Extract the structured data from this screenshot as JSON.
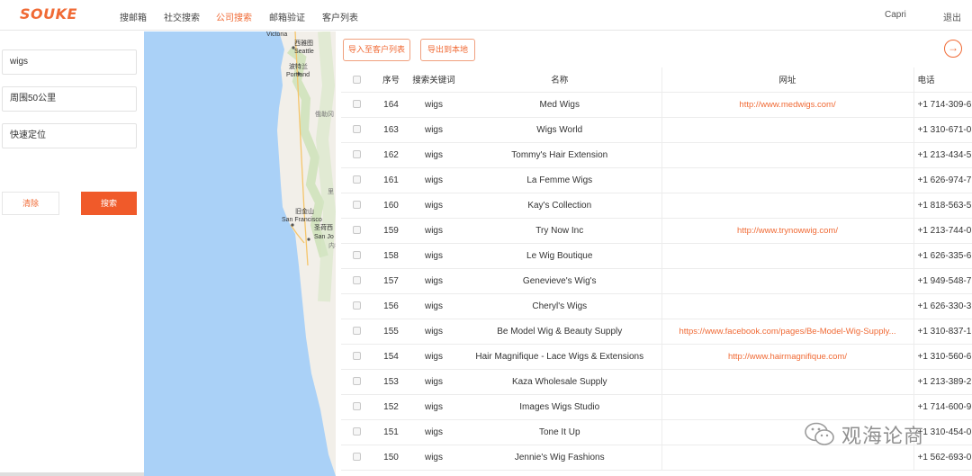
{
  "app": {
    "logo": "SOUKE"
  },
  "nav": {
    "items": [
      {
        "label": "搜邮箱",
        "active": false
      },
      {
        "label": "社交搜索",
        "active": false
      },
      {
        "label": "公司搜索",
        "active": true
      },
      {
        "label": "邮箱验证",
        "active": false
      },
      {
        "label": "客户列表",
        "active": false
      }
    ],
    "user": "Capri",
    "logout": "退出"
  },
  "search": {
    "keyword": "wigs",
    "radius": "周围50公里",
    "locate": "快速定位",
    "clear_label": "清除",
    "search_label": "搜索"
  },
  "map": {
    "labels": {
      "victoria": "Victoria",
      "seattle_cn": "西雅图",
      "seattle": "Seattle",
      "portland_cn": "波特兰",
      "portland": "Portland",
      "oregon": "俄勒冈",
      "sf_cn": "旧金山",
      "sf": "San Francisco",
      "sanjose_cn": "圣荷西",
      "sanjose": "San Jo",
      "reno": "里",
      "misc": "内华"
    }
  },
  "toolbar": {
    "import_label": "导入至客户列表",
    "export_label": "导出到本地",
    "next_icon": "arrow-right-circle-icon"
  },
  "table": {
    "headers": {
      "index": "序号",
      "keyword": "搜索关键词",
      "name": "名称",
      "url": "网址",
      "phone": "电话"
    },
    "rows": [
      {
        "index": "164",
        "keyword": "wigs",
        "name": "Med Wigs",
        "url": "http://www.medwigs.com/",
        "phone": "+1 714-309-6"
      },
      {
        "index": "163",
        "keyword": "wigs",
        "name": "Wigs World",
        "url": "",
        "phone": "+1 310-671-0"
      },
      {
        "index": "162",
        "keyword": "wigs",
        "name": "Tommy's Hair Extension",
        "url": "",
        "phone": "+1 213-434-5"
      },
      {
        "index": "161",
        "keyword": "wigs",
        "name": "La Femme Wigs",
        "url": "",
        "phone": "+1 626-974-7"
      },
      {
        "index": "160",
        "keyword": "wigs",
        "name": "Kay's Collection",
        "url": "",
        "phone": "+1 818-563-5"
      },
      {
        "index": "159",
        "keyword": "wigs",
        "name": "Try Now Inc",
        "url": "http://www.trynowwig.com/",
        "phone": "+1 213-744-0"
      },
      {
        "index": "158",
        "keyword": "wigs",
        "name": "Le Wig Boutique",
        "url": "",
        "phone": "+1 626-335-6"
      },
      {
        "index": "157",
        "keyword": "wigs",
        "name": "Genevieve's Wig's",
        "url": "",
        "phone": "+1 949-548-7"
      },
      {
        "index": "156",
        "keyword": "wigs",
        "name": "Cheryl's Wigs",
        "url": "",
        "phone": "+1 626-330-3"
      },
      {
        "index": "155",
        "keyword": "wigs",
        "name": "Be Model Wig & Beauty Supply",
        "url": "https://www.facebook.com/pages/Be-Model-Wig-Supply...",
        "phone": "+1 310-837-1"
      },
      {
        "index": "154",
        "keyword": "wigs",
        "name": "Hair Magnifique - Lace Wigs & Extensions",
        "url": "http://www.hairmagnifique.com/",
        "phone": "+1 310-560-6"
      },
      {
        "index": "153",
        "keyword": "wigs",
        "name": "Kaza Wholesale Supply",
        "url": "",
        "phone": "+1 213-389-2"
      },
      {
        "index": "152",
        "keyword": "wigs",
        "name": "Images Wigs Studio",
        "url": "",
        "phone": "+1 714-600-9"
      },
      {
        "index": "151",
        "keyword": "wigs",
        "name": "Tone It Up",
        "url": "",
        "phone": "+1 310-454-0"
      },
      {
        "index": "150",
        "keyword": "wigs",
        "name": "Jennie's Wig Fashions",
        "url": "",
        "phone": "+1 562-693-0"
      }
    ]
  },
  "watermark": {
    "text": "观海论商",
    "icon": "wechat-icon"
  },
  "colors": {
    "accent": "#f06a35",
    "water": "#aad1f7",
    "land": "#f2efe9"
  }
}
